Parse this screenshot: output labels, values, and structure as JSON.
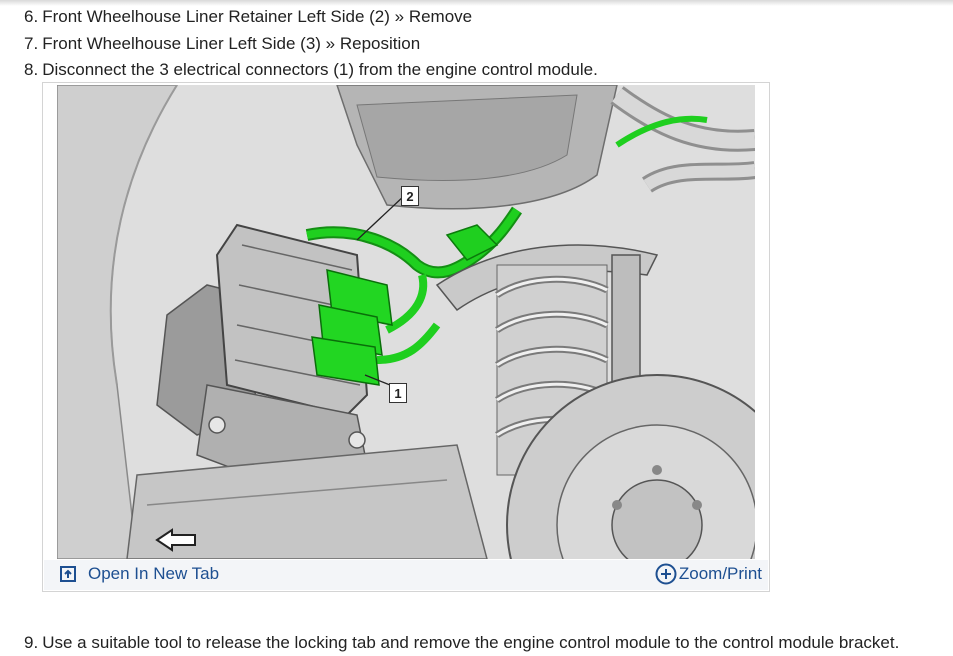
{
  "steps": [
    {
      "num": "6.",
      "text": "Front Wheelhouse Liner Retainer Left Side (2) » Remove"
    },
    {
      "num": "7.",
      "text": "Front Wheelhouse Liner Left Side (3) » Reposition"
    },
    {
      "num": "8.",
      "text": "Disconnect the 3 electrical connectors (1) from the engine control module."
    },
    {
      "num": "9.",
      "text": "Use a suitable tool to release the locking tab and remove the engine control module to the control module bracket."
    }
  ],
  "figure": {
    "callouts": [
      "2",
      "1"
    ],
    "open_tab_label": "Open In New Tab",
    "zoom_label": "Zoom/Print",
    "open_tab_icon": "open-in-new-tab-icon",
    "zoom_icon": "plus-circle-icon",
    "accent_color": "#1d4f91",
    "highlight_color": "#1fcf1f"
  }
}
